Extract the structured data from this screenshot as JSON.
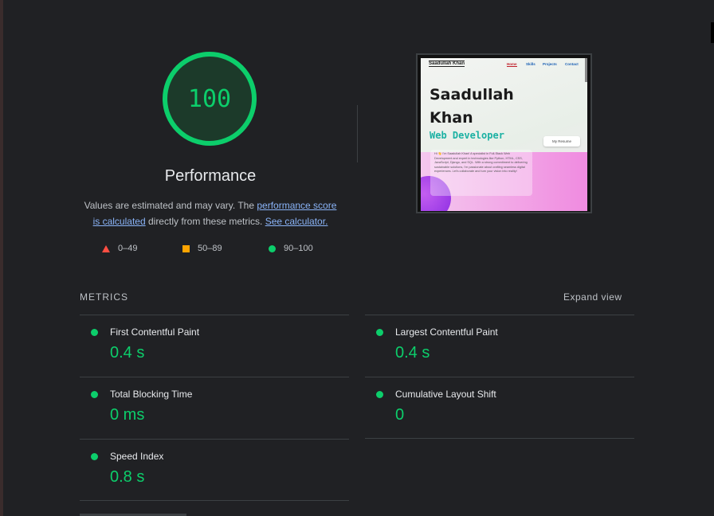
{
  "gauge": {
    "score": "100",
    "label": "Performance",
    "color": "#0cce6b"
  },
  "description": {
    "text1": "Values are estimated and may vary. The ",
    "link1": "performance score is calculated",
    "text2": " directly from these metrics. ",
    "link2": "See calculator."
  },
  "legend": {
    "fail": "0–49",
    "average": "50–89",
    "pass": "90–100"
  },
  "thumbnail": {
    "brand": "Saadullah Khan",
    "nav": [
      "Home",
      "Skills",
      "Projects",
      "Contact"
    ],
    "name_line1": "Saadullah",
    "name_line2": "Khan",
    "role": "Web Developer",
    "button": "My Resume",
    "intro": "Hi 👋 I'm Saadullah Khan! A specialist in Full-Stack Web Development and expert in technologies like Python, HTML, CSS, JavaScript, Django, and SQL. With a strong commitment to delivering sustainable solutions, I'm passionate about crafting seamless digital experiences. Let's collaborate and turn your vision into reality!"
  },
  "metrics": {
    "title": "METRICS",
    "expand_label": "Expand view",
    "items": [
      {
        "label": "First Contentful Paint",
        "value": "0.4 s"
      },
      {
        "label": "Largest Contentful Paint",
        "value": "0.4 s"
      },
      {
        "label": "Total Blocking Time",
        "value": "0 ms"
      },
      {
        "label": "Cumulative Layout Shift",
        "value": "0"
      },
      {
        "label": "Speed Index",
        "value": "0.8 s"
      }
    ]
  },
  "colors": {
    "pass": "#0cce6b",
    "average": "#ffa400",
    "fail": "#ff4e42",
    "link": "#8ab4f8",
    "background": "#202124"
  }
}
